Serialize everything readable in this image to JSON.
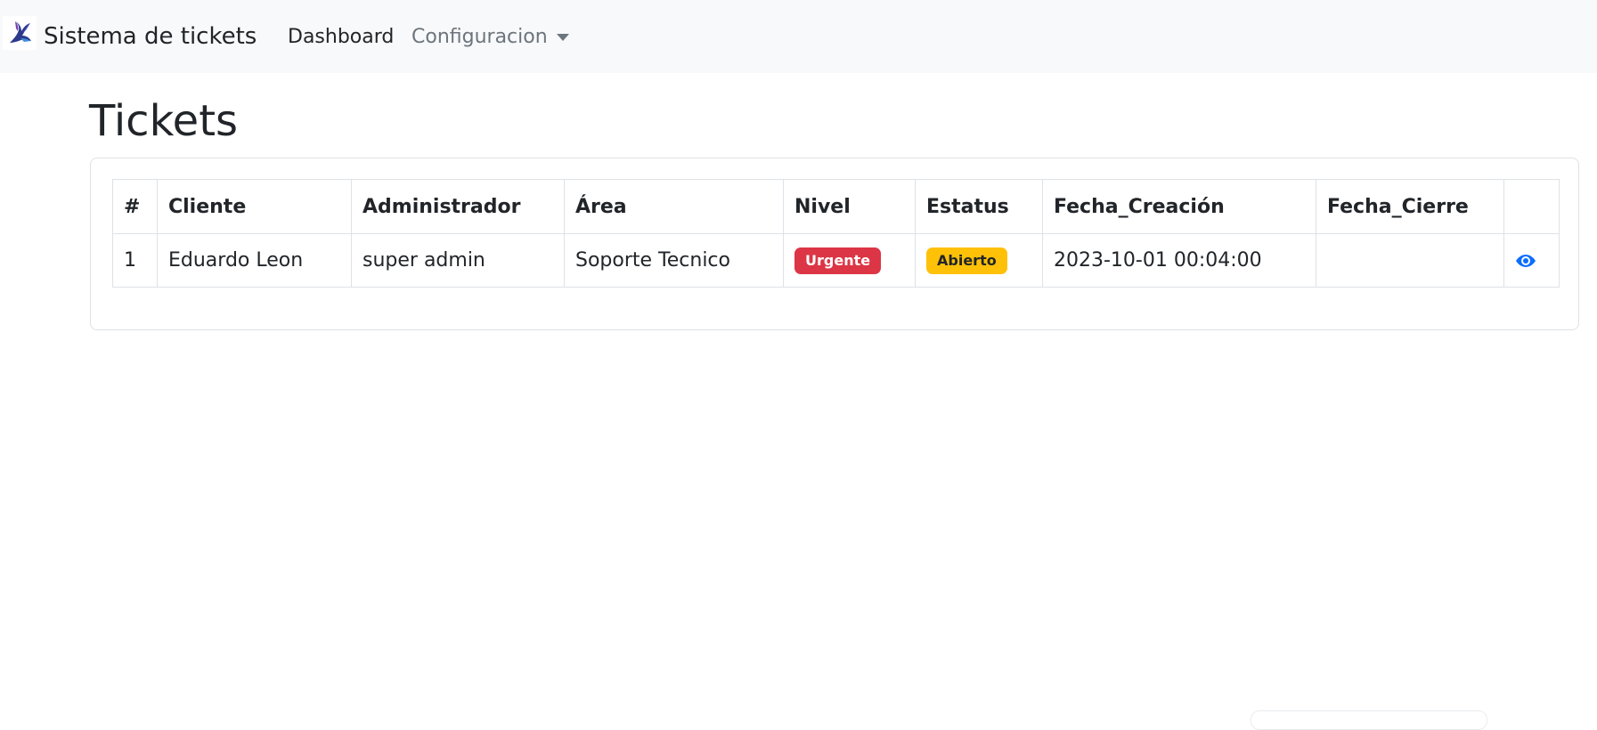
{
  "navbar": {
    "brand": "Sistema de tickets",
    "brand_logo_icon": "bird-logo-icon",
    "links": {
      "dashboard": "Dashboard",
      "configuracion": "Configuracion"
    }
  },
  "page": {
    "title": "Tickets"
  },
  "table": {
    "headers": [
      "#",
      "Cliente",
      "Administrador",
      "Área",
      "Nivel",
      "Estatus",
      "Fecha_Creación",
      "Fecha_Cierre",
      ""
    ],
    "rows": [
      {
        "id": "1",
        "cliente": "Eduardo Leon",
        "administrador": "super admin",
        "area": "Soporte Tecnico",
        "nivel": "Urgente",
        "estatus": "Abierto",
        "fecha_creacion": "2023-10-01 00:04:00",
        "fecha_cierre": "",
        "action_icon": "eye-icon"
      }
    ]
  },
  "colors": {
    "navbar_bg": "#f8f9fa",
    "urgente_badge": "#dc3545",
    "abierto_badge": "#ffc107",
    "action_link": "#0d6efd"
  }
}
